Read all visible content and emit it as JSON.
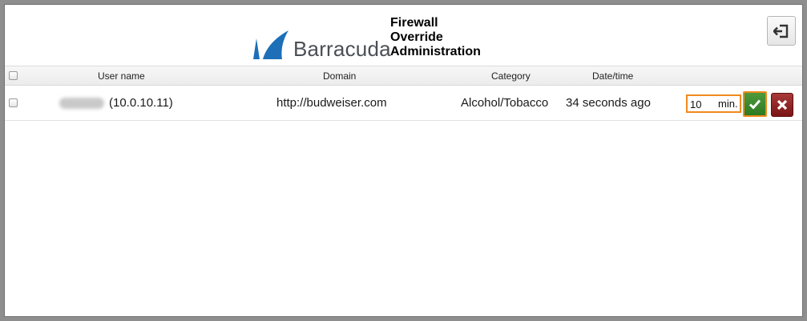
{
  "header": {
    "logo_text": "Barracuda",
    "title_lines": [
      "Firewall",
      "Override",
      "Administration"
    ],
    "exit_icon": "sign-out-icon"
  },
  "table": {
    "columns": {
      "username": "User name",
      "domain": "Domain",
      "category": "Category",
      "datetime": "Date/time"
    },
    "rows": [
      {
        "user_ip": "(10.0.10.11)",
        "domain": "http://budweiser.com",
        "category": "Alcohol/Tobacco",
        "datetime": "34 seconds ago",
        "duration_value": "10",
        "duration_unit": "min."
      }
    ]
  },
  "colors": {
    "accent_orange": "#f08a1c",
    "approve_green": "#2c7a22",
    "deny_red": "#7a1515",
    "brand_blue": "#1d6fb8"
  }
}
